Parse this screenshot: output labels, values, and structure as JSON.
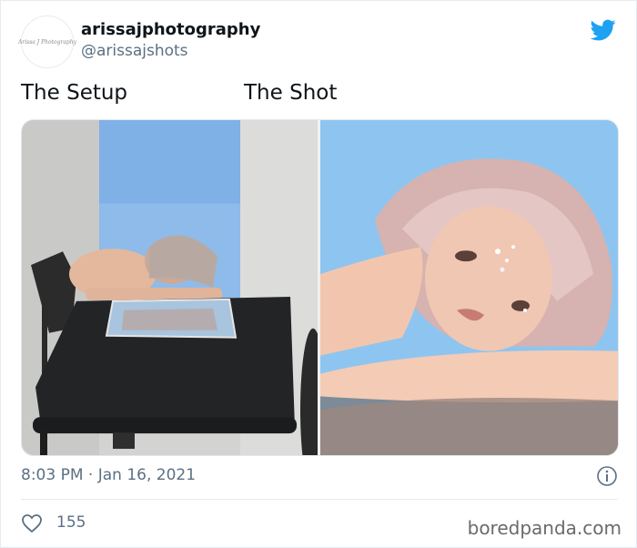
{
  "tweet": {
    "display_name": "arissajphotography",
    "handle": "@arissajshots",
    "avatar_text": "Arissa J Photography",
    "captions": [
      "The Setup",
      "The Shot"
    ],
    "timestamp": "8:03 PM · Jan 16, 2021",
    "like_count": "155"
  },
  "media": {
    "left_image": "behind-the-scenes photo setup with blue backdrop, table and mirror",
    "right_image": "final portrait with glitter makeup reflected in mirror"
  },
  "icons": {
    "brand": "twitter-bird-icon",
    "info": "info-icon",
    "like": "heart-icon"
  },
  "colors": {
    "twitter_blue": "#1da1f2",
    "secondary_text": "#5b7083",
    "backdrop_blue": "#7fb0e6"
  },
  "watermark": "boredpanda.com"
}
